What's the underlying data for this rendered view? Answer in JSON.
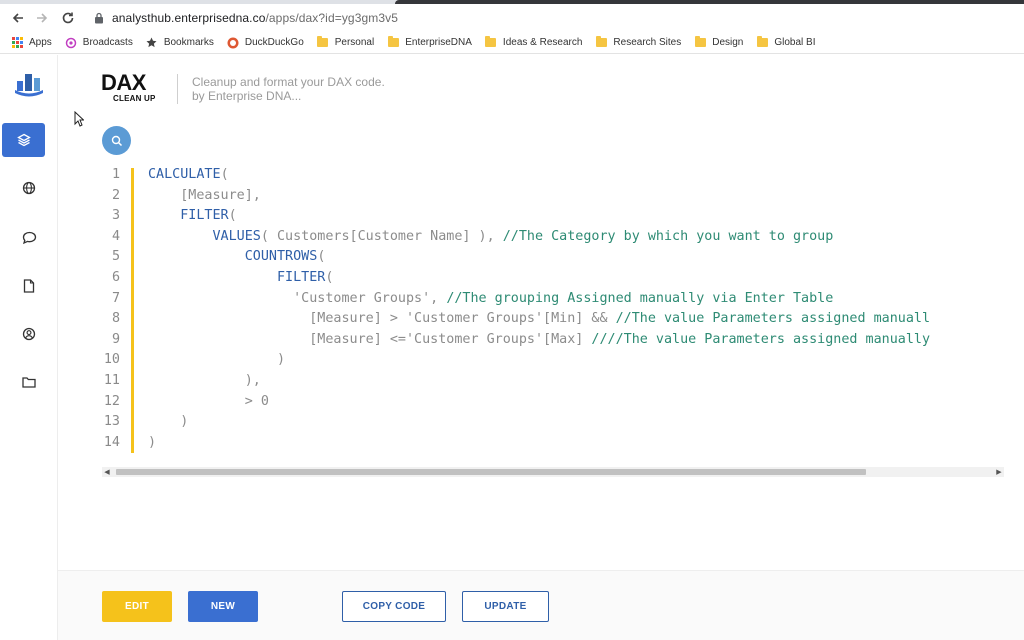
{
  "browser": {
    "url_host": "analysthub.enterprisedna.co",
    "url_path": "/apps/dax?id=yg3gm3v5",
    "bookmarks": [
      {
        "label": "Apps",
        "icon": "apps-grid-icon"
      },
      {
        "label": "Broadcasts",
        "icon": "broadcasts-icon"
      },
      {
        "label": "Bookmarks",
        "icon": "star-icon"
      },
      {
        "label": "DuckDuckGo",
        "icon": "duckduckgo-icon"
      },
      {
        "label": "Personal",
        "icon": "folder-icon"
      },
      {
        "label": "EnterpriseDNA",
        "icon": "folder-icon"
      },
      {
        "label": "Ideas & Research",
        "icon": "folder-icon"
      },
      {
        "label": "Research Sites",
        "icon": "folder-icon"
      },
      {
        "label": "Design",
        "icon": "folder-icon"
      },
      {
        "label": "Global BI",
        "icon": "folder-icon"
      }
    ]
  },
  "header": {
    "logo_big": "DAX",
    "logo_small": "CLEAN UP",
    "tagline_1": "Cleanup and format your DAX code.",
    "tagline_2": "by Enterprise DNA..."
  },
  "sidebar": {
    "items": [
      {
        "name": "layers",
        "icon": "layers-icon",
        "active": true
      },
      {
        "name": "globe",
        "icon": "globe-icon",
        "active": false
      },
      {
        "name": "chat",
        "icon": "chat-bubble-icon",
        "active": false
      },
      {
        "name": "document",
        "icon": "document-icon",
        "active": false
      },
      {
        "name": "user",
        "icon": "user-circle-icon",
        "active": false
      },
      {
        "name": "folder",
        "icon": "folder-icon",
        "active": false
      }
    ]
  },
  "editor": {
    "lines": [
      {
        "n": "1",
        "indent": "",
        "segs": [
          {
            "t": "CALCULATE",
            "c": "kw"
          },
          {
            "t": "(",
            "c": "st"
          }
        ]
      },
      {
        "n": "2",
        "indent": "    ",
        "segs": [
          {
            "t": "[Measure],",
            "c": "st"
          }
        ]
      },
      {
        "n": "3",
        "indent": "    ",
        "segs": [
          {
            "t": "FILTER",
            "c": "kw"
          },
          {
            "t": "(",
            "c": "st"
          }
        ]
      },
      {
        "n": "4",
        "indent": "        ",
        "segs": [
          {
            "t": "VALUES",
            "c": "kw"
          },
          {
            "t": "( Customers[Customer Name] ), ",
            "c": "st"
          },
          {
            "t": "//The Category by which you want to group",
            "c": "cm"
          }
        ]
      },
      {
        "n": "5",
        "indent": "            ",
        "segs": [
          {
            "t": "COUNTROWS",
            "c": "kw"
          },
          {
            "t": "(",
            "c": "st"
          }
        ]
      },
      {
        "n": "6",
        "indent": "                ",
        "segs": [
          {
            "t": "FILTER",
            "c": "kw"
          },
          {
            "t": "(",
            "c": "st"
          }
        ]
      },
      {
        "n": "7",
        "indent": "                  ",
        "segs": [
          {
            "t": "'Customer Groups', ",
            "c": "st"
          },
          {
            "t": "//The grouping Assigned manually via Enter Table",
            "c": "cm"
          }
        ]
      },
      {
        "n": "8",
        "indent": "                    ",
        "segs": [
          {
            "t": "[Measure] > 'Customer Groups'[Min] && ",
            "c": "st"
          },
          {
            "t": "//The value Parameters assigned manuall",
            "c": "cm"
          }
        ]
      },
      {
        "n": "9",
        "indent": "                    ",
        "segs": [
          {
            "t": "[Measure] <='Customer Groups'[Max] ",
            "c": "st"
          },
          {
            "t": "////The value Parameters assigned manually",
            "c": "cm"
          }
        ]
      },
      {
        "n": "10",
        "indent": "                ",
        "segs": [
          {
            "t": ")",
            "c": "st"
          }
        ]
      },
      {
        "n": "11",
        "indent": "            ",
        "segs": [
          {
            "t": "),",
            "c": "st"
          }
        ]
      },
      {
        "n": "12",
        "indent": "            ",
        "segs": [
          {
            "t": "> 0",
            "c": "st"
          }
        ]
      },
      {
        "n": "13",
        "indent": "    ",
        "segs": [
          {
            "t": ")",
            "c": "st"
          }
        ]
      },
      {
        "n": "14",
        "indent": "",
        "segs": [
          {
            "t": ")",
            "c": "st"
          }
        ]
      }
    ]
  },
  "footer": {
    "edit_label": "EDIT",
    "new_label": "NEW",
    "copy_label": "COPY CODE",
    "update_label": "UPDATE"
  },
  "colors": {
    "accent_blue": "#3a6fd1",
    "accent_yellow": "#f5c21b",
    "keyword": "#2f5fa8",
    "comment": "#2e8b74"
  }
}
